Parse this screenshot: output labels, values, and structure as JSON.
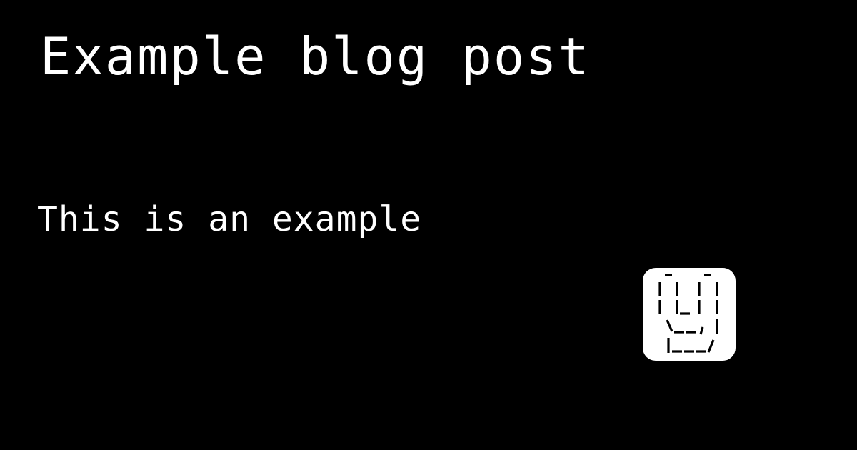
{
  "post": {
    "title": "Example blog post",
    "description": "This is an example"
  },
  "logo": {
    "icon": "ascii-art-y-logo-icon",
    "background": "#ffffff",
    "foreground": "#000000"
  },
  "colors": {
    "background": "#000000",
    "text": "#ffffff"
  }
}
